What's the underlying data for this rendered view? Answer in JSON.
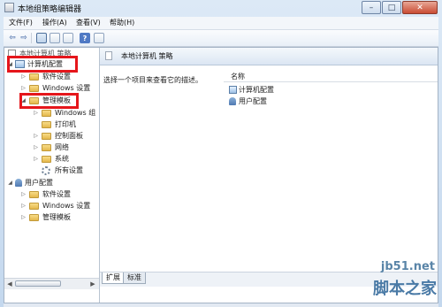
{
  "window": {
    "title": "本地组策略编辑器",
    "controls": {
      "minimize": "–",
      "maximize": "□",
      "close": "✕"
    }
  },
  "menubar": {
    "items": [
      {
        "label": "文件(F)"
      },
      {
        "label": "操作(A)"
      },
      {
        "label": "查看(V)"
      },
      {
        "label": "帮助(H)"
      }
    ]
  },
  "toolbar": {
    "back_glyph": "⇦",
    "forward_glyph": "⇨",
    "help_glyph": "?",
    "icons": [
      "back-icon",
      "forward-icon",
      "show-hide-tree-icon",
      "properties-icon",
      "export-list-icon",
      "help-icon",
      "filter-icon"
    ]
  },
  "tree": {
    "root": "本地计算机 策略",
    "items": [
      {
        "label": "计算机配置",
        "arrow": "◢",
        "icon": "computer-config-icon"
      },
      {
        "label": "软件设置",
        "arrow": "▷",
        "icon": "folder-icon"
      },
      {
        "label": "Windows 设置",
        "arrow": "▷",
        "icon": "folder-icon"
      },
      {
        "label": "管理模板",
        "arrow": "◢",
        "icon": "folder-icon"
      },
      {
        "label": "Windows 组",
        "arrow": "▷",
        "icon": "folder-icon"
      },
      {
        "label": "打印机",
        "arrow": "",
        "icon": "folder-icon"
      },
      {
        "label": "控制面板",
        "arrow": "▷",
        "icon": "folder-icon"
      },
      {
        "label": "网络",
        "arrow": "▷",
        "icon": "folder-icon"
      },
      {
        "label": "系统",
        "arrow": "▷",
        "icon": "folder-icon"
      },
      {
        "label": "所有设置",
        "arrow": "",
        "icon": "settings-icon"
      },
      {
        "label": "用户配置",
        "arrow": "◢",
        "icon": "user-config-icon"
      },
      {
        "label": "软件设置",
        "arrow": "▷",
        "icon": "folder-icon"
      },
      {
        "label": "Windows 设置",
        "arrow": "▷",
        "icon": "folder-icon"
      },
      {
        "label": "管理模板",
        "arrow": "▷",
        "icon": "folder-icon"
      }
    ]
  },
  "content": {
    "header": "本地计算机 策略",
    "description": "选择一个项目来查看它的描述。",
    "column_name": "名称",
    "items": [
      {
        "label": "计算机配置",
        "icon": "computer-config-icon"
      },
      {
        "label": "用户配置",
        "icon": "user-config-icon"
      }
    ],
    "tabs": [
      {
        "label": "扩展"
      },
      {
        "label": "标准"
      }
    ]
  },
  "scroll_arrows": {
    "left": "◀",
    "right": "▶"
  },
  "watermark": {
    "site": "jb51.net",
    "name": "脚本之家"
  },
  "colors": {
    "highlight_box": "#e5161b",
    "window_frame": "#c4d8ee"
  }
}
